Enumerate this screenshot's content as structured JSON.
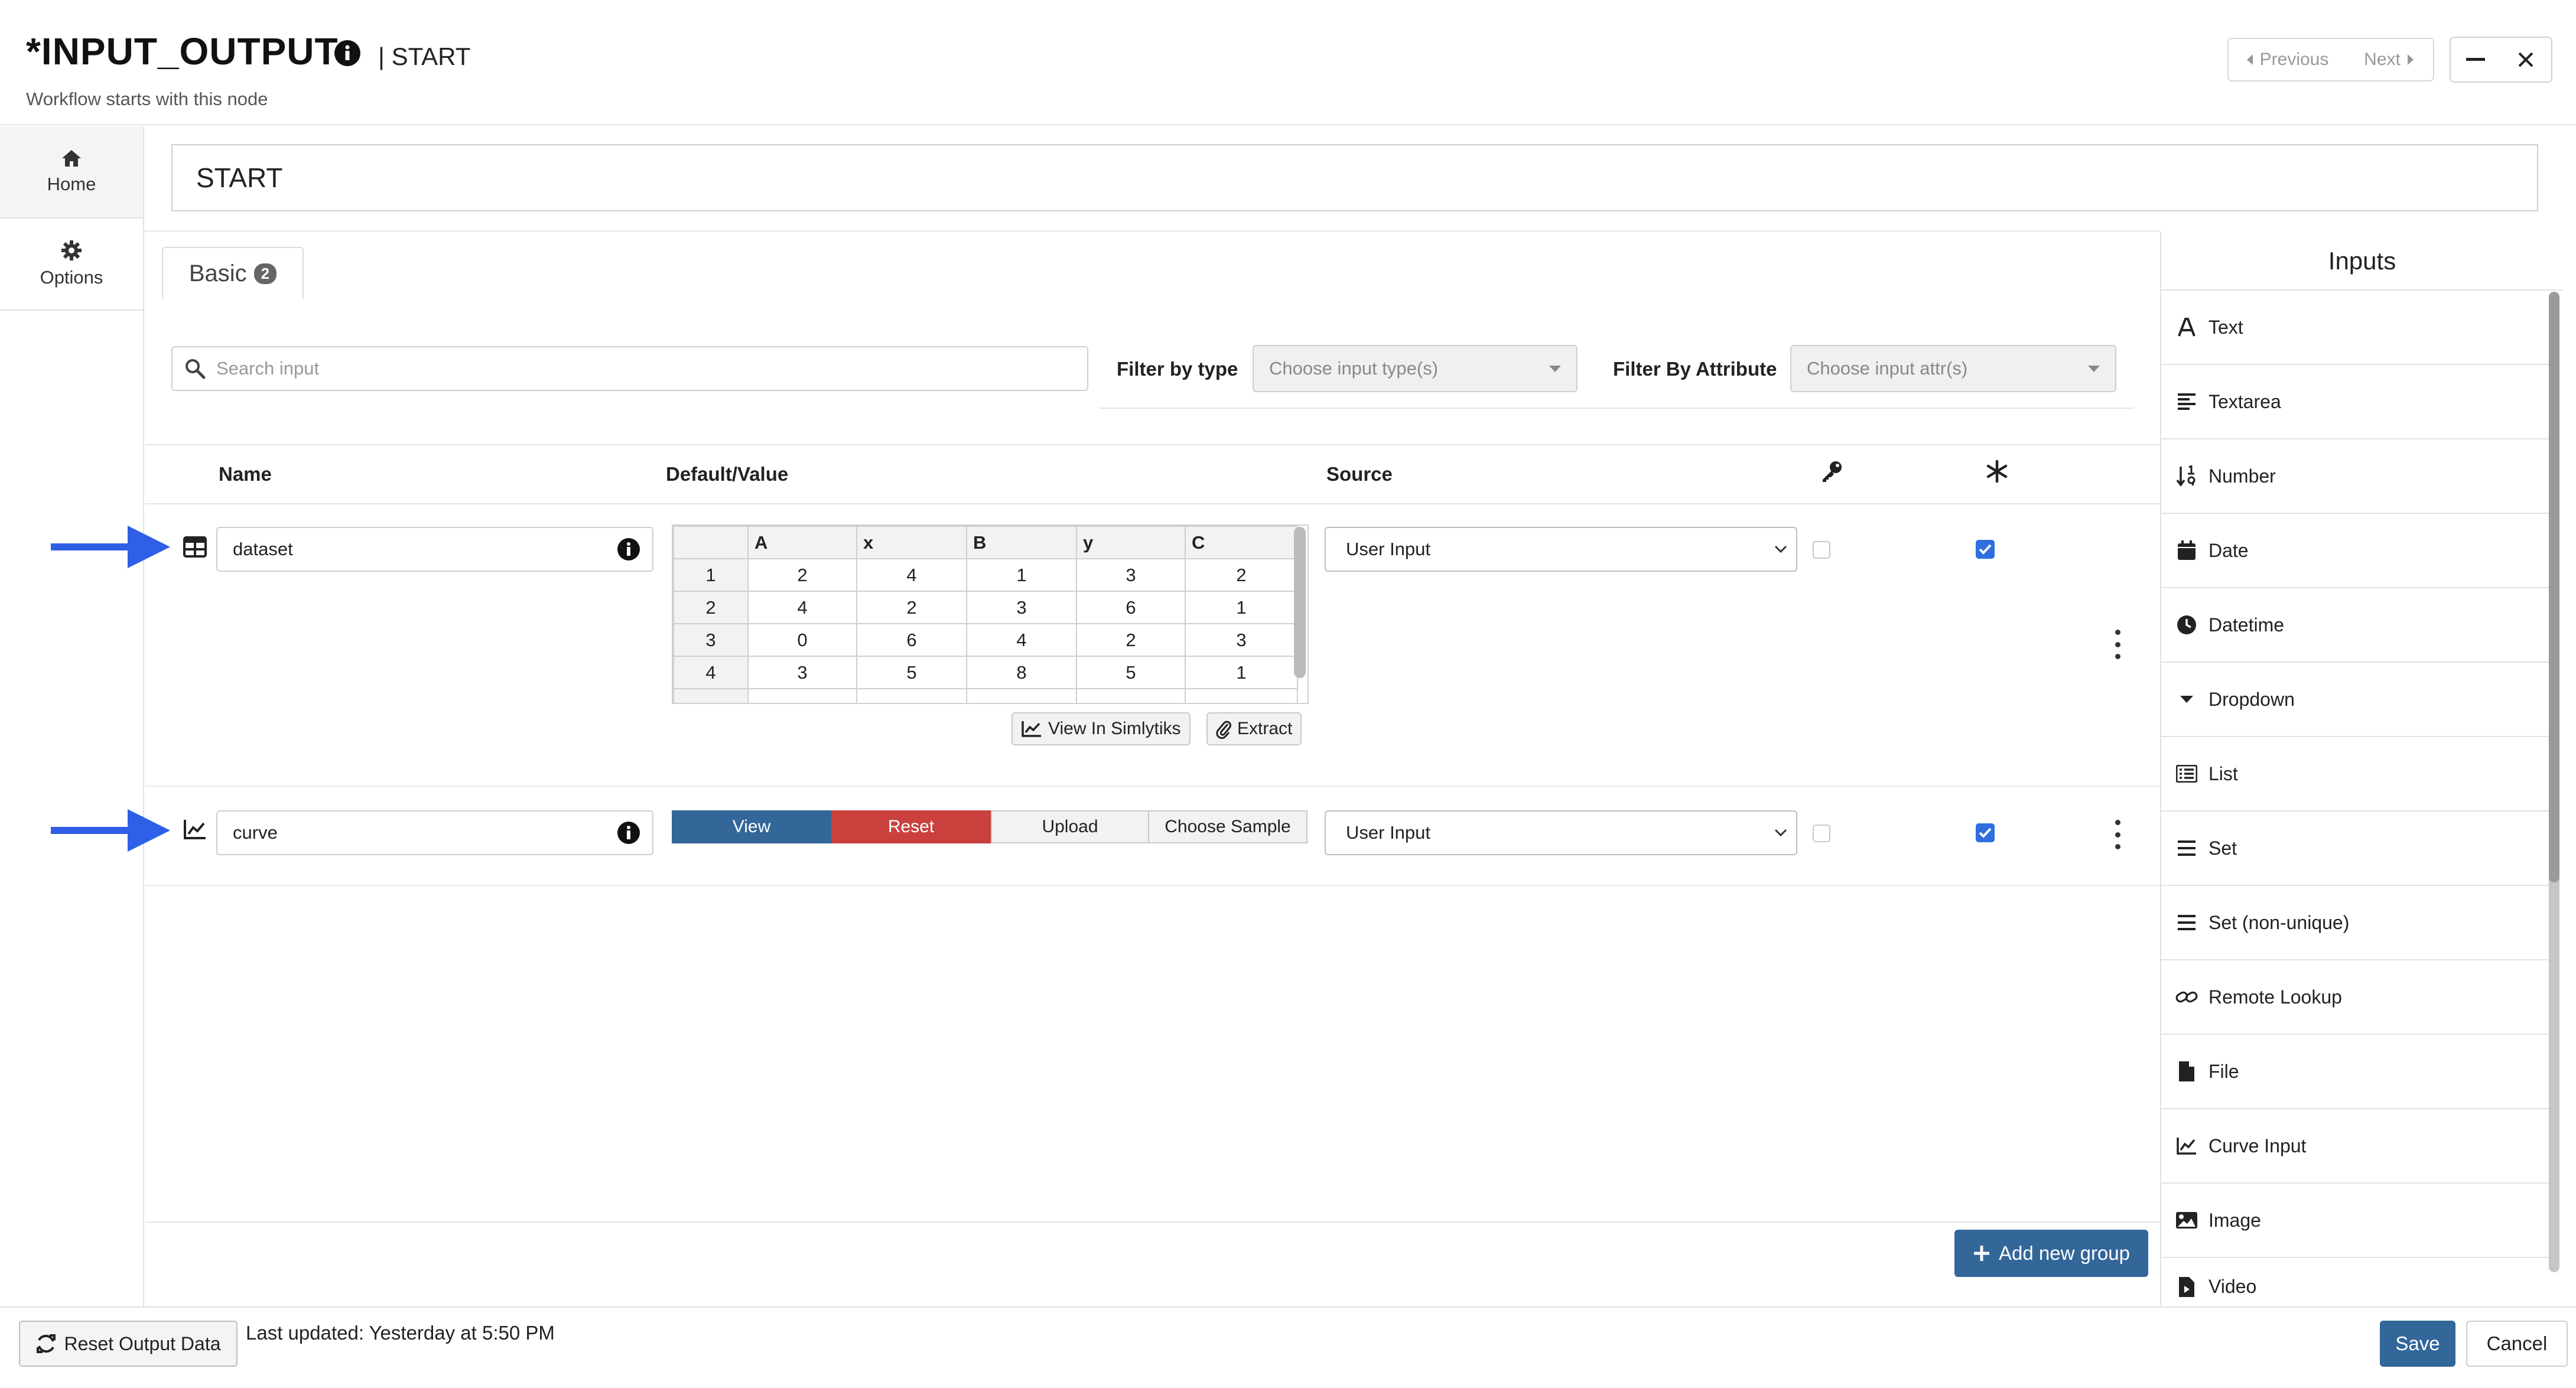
{
  "header": {
    "title": "*INPUT_OUTPUT",
    "title_suffix": "| START",
    "subtitle": "Workflow starts with this node",
    "previous_label": "Previous",
    "next_label": "Next"
  },
  "sidebar": {
    "items": [
      {
        "label": "Home",
        "icon": "home-icon"
      },
      {
        "label": "Options",
        "icon": "gear-icon"
      }
    ]
  },
  "node_name": "START",
  "tabs": [
    {
      "label": "Basic",
      "count": "2"
    }
  ],
  "filters": {
    "search_placeholder": "Search input",
    "type_label": "Filter by type",
    "type_placeholder": "Choose input type(s)",
    "attr_label": "Filter By Attribute",
    "attr_placeholder": "Choose input attr(s)"
  },
  "table": {
    "headers": {
      "name": "Name",
      "default": "Default/Value",
      "source": "Source"
    },
    "rows": [
      {
        "name": "dataset",
        "icon": "table-icon",
        "source": "User Input",
        "key_checked": false,
        "required_checked": true,
        "grid": {
          "columns": [
            "A",
            "x",
            "B",
            "y",
            "C"
          ],
          "rows": [
            {
              "index": "1",
              "cells": [
                "2",
                "4",
                "1",
                "3",
                "2"
              ]
            },
            {
              "index": "2",
              "cells": [
                "4",
                "2",
                "3",
                "6",
                "1"
              ]
            },
            {
              "index": "3",
              "cells": [
                "0",
                "6",
                "4",
                "2",
                "3"
              ]
            },
            {
              "index": "4",
              "cells": [
                "3",
                "5",
                "8",
                "5",
                "1"
              ]
            }
          ]
        },
        "buttons": {
          "view_simlytiks": "View In Simlytiks",
          "extract": "Extract"
        }
      },
      {
        "name": "curve",
        "icon": "line-chart-icon",
        "source": "User Input",
        "key_checked": false,
        "required_checked": true,
        "buttons": {
          "view": "View",
          "reset": "Reset",
          "upload": "Upload",
          "choose_sample": "Choose Sample"
        }
      }
    ]
  },
  "add_group_label": "Add new group",
  "inputs_panel": {
    "title": "Inputs",
    "items": [
      {
        "label": "Text",
        "icon": "text-icon"
      },
      {
        "label": "Textarea",
        "icon": "textarea-icon"
      },
      {
        "label": "Number",
        "icon": "sort-numeric-icon"
      },
      {
        "label": "Date",
        "icon": "calendar-icon"
      },
      {
        "label": "Datetime",
        "icon": "clock-icon"
      },
      {
        "label": "Dropdown",
        "icon": "caret-down-icon"
      },
      {
        "label": "List",
        "icon": "list-icon"
      },
      {
        "label": "Set",
        "icon": "bars-icon"
      },
      {
        "label": "Set (non-unique)",
        "icon": "bars-icon"
      },
      {
        "label": "Remote Lookup",
        "icon": "link-icon"
      },
      {
        "label": "File",
        "icon": "file-icon"
      },
      {
        "label": "Curve Input",
        "icon": "line-chart-icon"
      },
      {
        "label": "Image",
        "icon": "image-icon"
      },
      {
        "label": "Video",
        "icon": "video-file-icon"
      }
    ]
  },
  "footer": {
    "reset_output": "Reset Output Data",
    "last_updated": "Last updated: Yesterday at 5:50 PM",
    "save": "Save",
    "cancel": "Cancel"
  },
  "colors": {
    "primary": "#336699",
    "danger": "#c9403d",
    "checkbox": "#2f6ee0",
    "arrow": "#2f5fe6"
  }
}
